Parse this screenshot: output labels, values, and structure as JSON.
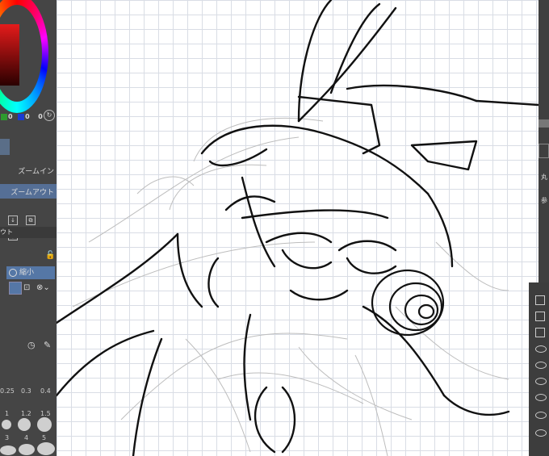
{
  "color_panel": {
    "r_value": "0",
    "g_value": "0",
    "b_value": "0",
    "main_color": "#e51b1b"
  },
  "navigator": {
    "zoom_in_label": "ズームイン",
    "zoom_out_label": "ズームアウト",
    "cut_label": "ウト"
  },
  "tool_property": {
    "zoom_out_tool_label": "縮小"
  },
  "brush_size": {
    "values": [
      "0.25",
      "0.3",
      "0.4",
      "1",
      "1.2",
      "1.5",
      "3",
      "4",
      "5"
    ]
  },
  "right_panel": {
    "label_top": "丸",
    "label_mid": "参"
  }
}
